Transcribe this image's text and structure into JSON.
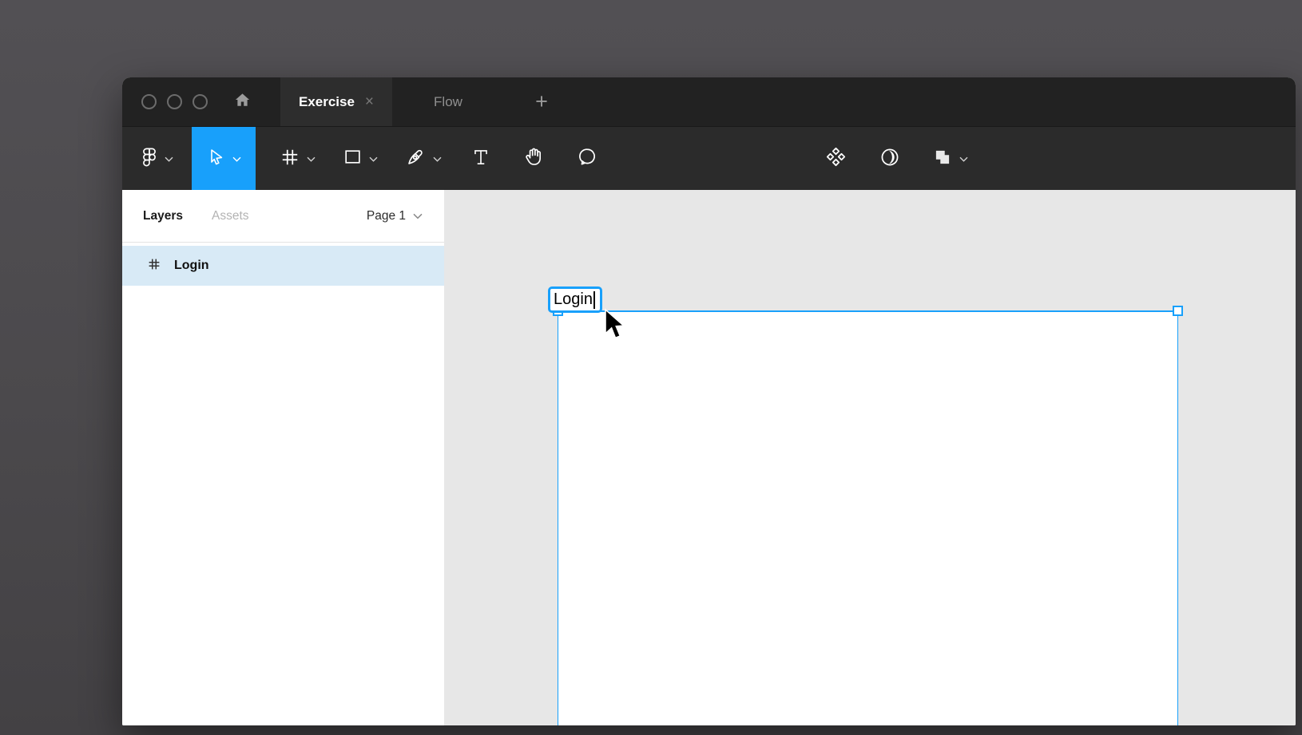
{
  "titlebar": {
    "traffic_lights": [
      "close",
      "minimize",
      "zoom"
    ],
    "tabs": [
      {
        "label": "Exercise",
        "active": true,
        "close_label": "×"
      },
      {
        "label": "Flow",
        "active": false
      }
    ],
    "new_tab_label": "+"
  },
  "toolbar": {
    "tools": [
      {
        "name": "main-menu",
        "icon": "figma-logo-icon",
        "has_dropdown": true,
        "selected": false
      },
      {
        "name": "move-tool",
        "icon": "move-cursor-icon",
        "has_dropdown": true,
        "selected": true
      },
      {
        "name": "frame-tool",
        "icon": "frame-hash-icon",
        "has_dropdown": true,
        "selected": false
      },
      {
        "name": "shape-tool",
        "icon": "rectangle-icon",
        "has_dropdown": true,
        "selected": false
      },
      {
        "name": "pen-tool",
        "icon": "pen-icon",
        "has_dropdown": true,
        "selected": false
      },
      {
        "name": "text-tool",
        "icon": "text-t-icon",
        "has_dropdown": false,
        "selected": false
      },
      {
        "name": "hand-tool",
        "icon": "hand-icon",
        "has_dropdown": false,
        "selected": false
      },
      {
        "name": "comment-tool",
        "icon": "speech-bubble-icon",
        "has_dropdown": false,
        "selected": false
      }
    ],
    "object_tools": [
      {
        "name": "create-component",
        "icon": "component-diamonds-icon"
      },
      {
        "name": "use-as-mask",
        "icon": "mask-moon-icon"
      },
      {
        "name": "boolean-groups",
        "icon": "boolean-union-icon",
        "has_dropdown": true
      }
    ]
  },
  "sidebar": {
    "tab_layers": "Layers",
    "tab_assets": "Assets",
    "page_selector": "Page 1",
    "layers": [
      {
        "name": "Login",
        "type": "frame",
        "selected": true
      }
    ]
  },
  "canvas": {
    "frame_name_editor_value": "Login",
    "selected_frame": {
      "name": "Login"
    }
  },
  "colors": {
    "accent": "#18a0fb",
    "selected_row": "#d8eaf6",
    "canvas_bg": "#e7e7e7",
    "titlebar_bg": "#222222",
    "toolbar_bg": "#2b2b2b"
  }
}
